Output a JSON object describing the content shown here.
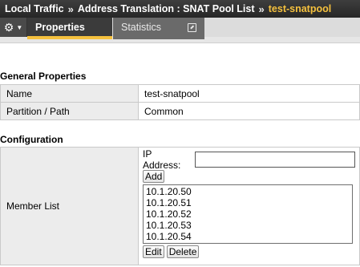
{
  "breadcrumb": {
    "items": [
      "Local Traffic",
      "Address Translation : SNAT Pool List"
    ],
    "separator": "»",
    "current": "test-snatpool"
  },
  "tabs": {
    "gear_icon": "gear-icon",
    "properties": "Properties",
    "statistics": "Statistics"
  },
  "general": {
    "title": "General Properties",
    "rows": [
      {
        "label": "Name",
        "value": "test-snatpool"
      },
      {
        "label": "Partition / Path",
        "value": "Common"
      }
    ]
  },
  "configuration": {
    "title": "Configuration",
    "member_label": "Member List",
    "ip_label": "IP Address:",
    "ip_value": "",
    "add_label": "Add",
    "members": [
      "10.1.20.50",
      "10.1.20.51",
      "10.1.20.52",
      "10.1.20.53",
      "10.1.20.54"
    ],
    "edit_label": "Edit",
    "delete_label": "Delete"
  },
  "colors": {
    "accent": "#f5c13e",
    "header_bg": "#2e2e2e",
    "label_bg": "#ececec"
  }
}
